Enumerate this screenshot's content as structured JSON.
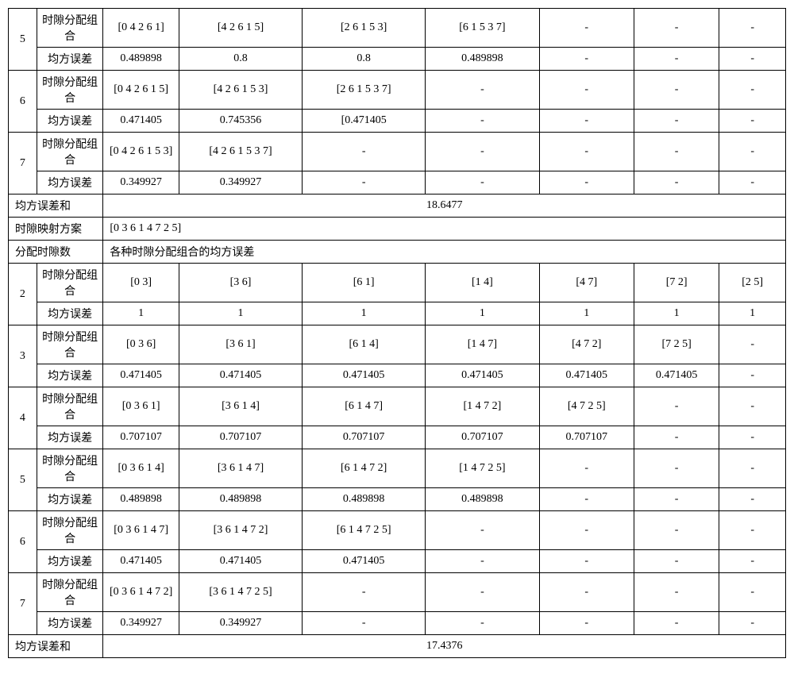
{
  "labels": {
    "slot_combo": "时隙分配组合",
    "mse": "均方误差",
    "mse_sum": "均方误差和",
    "slot_mapping_scheme": "时隙映射方案",
    "alloc_slot_count": "分配时隙数",
    "mse_of_combos": "各种时隙分配组合的均方误差"
  },
  "top": {
    "rows": [
      {
        "idx": "5",
        "combo": [
          "[0 4 2 6 1]",
          "[4 2 6 1 5]",
          "[2 6 1 5 3]",
          "[6 1 5 3 7]",
          "-",
          "-",
          "-"
        ],
        "mse": [
          "0.489898",
          "0.8",
          "0.8",
          "0.489898",
          "-",
          "-",
          "-"
        ]
      },
      {
        "idx": "6",
        "combo": [
          "[0 4 2 6 1 5]",
          "[4 2 6 1 5 3]",
          "[2 6 1 5 3 7]",
          "-",
          "-",
          "-",
          "-"
        ],
        "mse": [
          "0.471405",
          "0.745356",
          "[0.471405",
          "-",
          "-",
          "-",
          "-"
        ]
      },
      {
        "idx": "7",
        "combo": [
          "[0 4 2 6 1 5 3]",
          "[4 2 6 1 5 3 7]",
          "-",
          "-",
          "-",
          "-",
          "-"
        ],
        "mse": [
          "0.349927",
          "0.349927",
          "-",
          "-",
          "-",
          "-",
          "-"
        ]
      }
    ],
    "mse_sum": "18.6477"
  },
  "mapping": "[0 3 6 1 4 7 2 5]",
  "bottom": {
    "rows": [
      {
        "idx": "2",
        "combo": [
          "[0 3]",
          "[3 6]",
          "[6 1]",
          "[1 4]",
          "[4 7]",
          "[7 2]",
          "[2 5]"
        ],
        "mse": [
          "1",
          "1",
          "1",
          "1",
          "1",
          "1",
          "1"
        ]
      },
      {
        "idx": "3",
        "combo": [
          "[0 3 6]",
          "[3 6 1]",
          "[6 1 4]",
          "[1 4 7]",
          "[4 7 2]",
          "[7 2 5]",
          "-"
        ],
        "mse": [
          "0.471405",
          "0.471405",
          "0.471405",
          "0.471405",
          "0.471405",
          "0.471405",
          "-"
        ]
      },
      {
        "idx": "4",
        "combo": [
          "[0 3 6 1]",
          "[3 6 1 4]",
          "[6 1 4 7]",
          "[1 4 7 2]",
          "[4 7 2 5]",
          "-",
          "-"
        ],
        "mse": [
          "0.707107",
          "0.707107",
          "0.707107",
          "0.707107",
          "0.707107",
          "-",
          "-"
        ]
      },
      {
        "idx": "5",
        "combo": [
          "[0 3 6 1 4]",
          "[3 6 1 4 7]",
          "[6 1 4 7 2]",
          "[1 4 7 2 5]",
          "-",
          "-",
          "-"
        ],
        "mse": [
          "0.489898",
          "0.489898",
          "0.489898",
          "0.489898",
          "-",
          "-",
          "-"
        ]
      },
      {
        "idx": "6",
        "combo": [
          "[0 3 6 1 4 7]",
          "[3 6 1 4 7 2]",
          "[6 1 4 7 2 5]",
          "-",
          "-",
          "-",
          "-"
        ],
        "mse": [
          "0.471405",
          "0.471405",
          "0.471405",
          "-",
          "-",
          "-",
          "-"
        ]
      },
      {
        "idx": "7",
        "combo": [
          "[0 3 6 1 4 7 2]",
          "[3 6 1 4 7 2 5]",
          "-",
          "-",
          "-",
          "-",
          "-"
        ],
        "mse": [
          "0.349927",
          "0.349927",
          "-",
          "-",
          "-",
          "-",
          "-"
        ]
      }
    ],
    "mse_sum": "17.4376"
  }
}
